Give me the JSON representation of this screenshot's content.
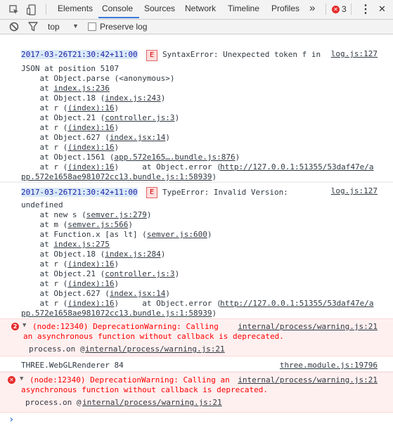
{
  "tabs": [
    {
      "label": "Elements"
    },
    {
      "label": "Console"
    },
    {
      "label": "Sources"
    },
    {
      "label": "Network"
    },
    {
      "label": "Timeline"
    },
    {
      "label": "Profiles"
    }
  ],
  "more_tabs": "»",
  "error_count": "3",
  "kebab": "⋮",
  "close": "✕",
  "filter": {
    "context": "top",
    "context_arrow": "▼",
    "preserve_log": "Preserve log"
  },
  "messages": {
    "m1": {
      "timestamp": "2017-03-26T21:30:42+11:00",
      "flag": "E",
      "text": "SyntaxError: Unexpected token f in",
      "source": "log.js:127",
      "cont": "JSON at position 5107",
      "stack": [
        {
          "pre": "    at Object.parse (<anonymous>)",
          "link": "",
          "post": ""
        },
        {
          "pre": "    at ",
          "link": "index.js:236",
          "post": ""
        },
        {
          "pre": "    at Object.18 (",
          "link": "index.js:243",
          "post": ")"
        },
        {
          "pre": "    at r (",
          "link": "(index):16",
          "post": ")"
        },
        {
          "pre": "    at Object.21 (",
          "link": "controller.js:3",
          "post": ")"
        },
        {
          "pre": "    at r (",
          "link": "(index):16",
          "post": ")"
        },
        {
          "pre": "    at Object.627 (",
          "link": "index.jsx:14",
          "post": ")"
        },
        {
          "pre": "    at r (",
          "link": "(index):16",
          "post": ")"
        },
        {
          "pre": "    at Object.1561 (",
          "link": "app.572e165….bundle.js:876",
          "post": ")"
        },
        {
          "pre": "    at r (",
          "link": "(index):16",
          "post": ")     at Object.error ("
        },
        {
          "pre": "",
          "link": "pp.572e1658ae981072cc13.bundle.js:1:58939",
          "post": ")"
        }
      ],
      "error_url": "http://127.0.0.1:51355/53daf47e/a"
    },
    "m2": {
      "timestamp": "2017-03-26T21:30:42+11:00",
      "flag": "E",
      "text": "TypeError: Invalid Version:",
      "source": "log.js:127",
      "cont": "undefined",
      "stack": [
        {
          "pre": "    at new s (",
          "link": "semver.js:279",
          "post": ")"
        },
        {
          "pre": "    at m (",
          "link": "semver.js:566",
          "post": ")"
        },
        {
          "pre": "    at Function.x [as lt] (",
          "link": "semver.js:600",
          "post": ")"
        },
        {
          "pre": "    at ",
          "link": "index.js:275",
          "post": ""
        },
        {
          "pre": "    at Object.18 (",
          "link": "index.js:284",
          "post": ")"
        },
        {
          "pre": "    at r (",
          "link": "(index):16",
          "post": ")"
        },
        {
          "pre": "    at Object.21 (",
          "link": "controller.js:3",
          "post": ")"
        },
        {
          "pre": "    at r (",
          "link": "(index):16",
          "post": ")"
        },
        {
          "pre": "    at Object.627 (",
          "link": "index.jsx:14",
          "post": ")"
        },
        {
          "pre": "    at r (",
          "link": "(index):16",
          "post": ")     at Object.error ("
        },
        {
          "pre": "",
          "link": "pp.572e1658ae981072cc13.bundle.js:1:58939",
          "post": ")"
        }
      ],
      "error_url": "http://127.0.0.1:51355/53daf47e/a"
    },
    "m3": {
      "repeat": "2",
      "arrow": "▼",
      "text1": "(node:12340) DeprecationWarning: Calling",
      "text2": "an asynchronous function without callback is deprecated.",
      "source": "internal/process/warning.js:21",
      "trace_pre": "process.on @ ",
      "trace_link": "internal/process/warning.js:21"
    },
    "m4": {
      "text": "THREE.WebGLRenderer 84",
      "source": "three.module.js:19796"
    },
    "m5": {
      "icon": "✕",
      "arrow": "▼",
      "text1": "(node:12340) DeprecationWarning: Calling an",
      "text2": "asynchronous function without callback is deprecated.",
      "source": "internal/process/warning.js:21",
      "trace_pre": "process.on @ ",
      "trace_link": "internal/process/warning.js:21"
    }
  },
  "prompt": "›"
}
